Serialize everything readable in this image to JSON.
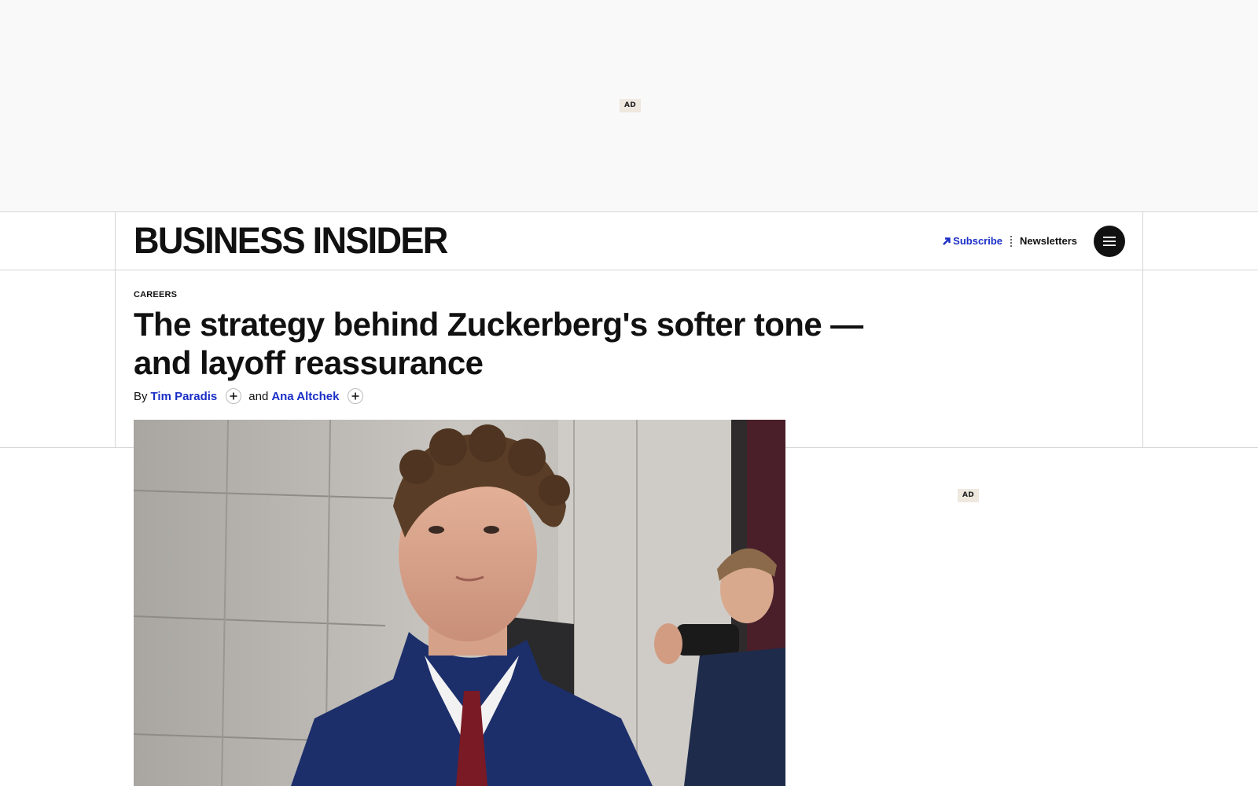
{
  "ads": {
    "top_label": "AD",
    "side_label": "AD"
  },
  "header": {
    "logo": "BUSINESS INSIDER",
    "subscribe": "Subscribe",
    "newsletters": "Newsletters",
    "menu_icon": "hamburger-menu-icon"
  },
  "article": {
    "category": "CAREERS",
    "headline": "The strategy behind Zuckerberg's softer tone — and layoff reassurance",
    "byline_prefix": "By",
    "authors": [
      "Tim Paradis",
      "Ana Altchek"
    ],
    "and_word": "and",
    "follow_icon": "plus-icon"
  },
  "colors": {
    "link_blue": "#1a2ec7",
    "text": "#111111",
    "ad_bg": "#f9f9f9"
  }
}
